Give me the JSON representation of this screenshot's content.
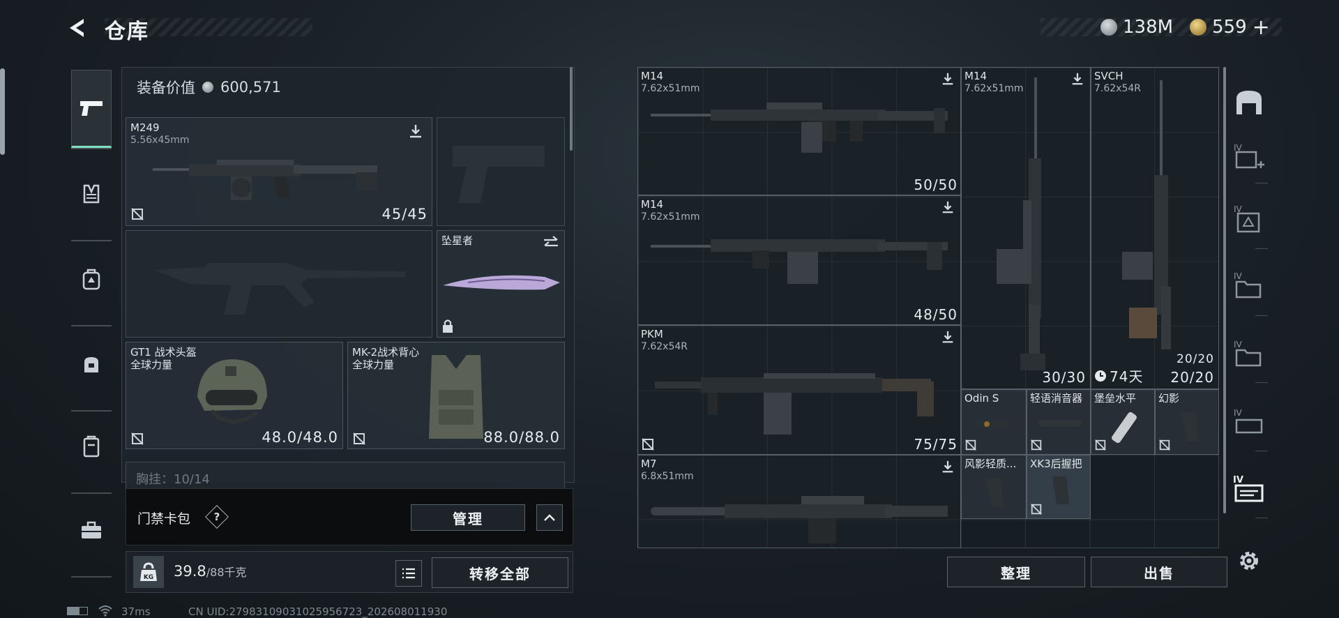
{
  "header": {
    "title": "仓库",
    "currency_silver": "138M",
    "currency_gold": "559",
    "add_label": "+"
  },
  "equipment": {
    "value_label": "装备价值",
    "value": "600,571"
  },
  "slots": {
    "primary": {
      "name": "M249",
      "caliber": "5.56x45mm",
      "ammo": "45/45"
    },
    "melee": {
      "name": "坠星者"
    },
    "helmet": {
      "name": "GT1 战术头盔",
      "brand": "全球力量",
      "durability": "48.0/48.0"
    },
    "vest": {
      "name": "MK-2战术背心",
      "brand": "全球力量",
      "durability": "88.0/88.0"
    },
    "chest_rig_partial": "胸挂：10/14"
  },
  "keycard": {
    "label": "门禁卡包",
    "help": "?",
    "manage_label": "管理"
  },
  "weight": {
    "badge": "KG",
    "current": "39.8",
    "max": "/88千克",
    "transfer_all_label": "转移全部"
  },
  "storage": {
    "weapons": [
      {
        "name": "M14",
        "caliber": "7.62x51mm",
        "ammo": "50/50"
      },
      {
        "name": "M14",
        "caliber": "7.62x51mm",
        "ammo": "48/50"
      },
      {
        "name": "PKM",
        "caliber": "7.62x54R",
        "ammo": "75/75"
      },
      {
        "name": "M7",
        "caliber": "6.8x51mm",
        "ammo": ""
      },
      {
        "name": "M14",
        "caliber": "7.62x51mm",
        "ammo": "30/30"
      },
      {
        "name": "SVCH",
        "caliber": "7.62x54R",
        "ammo": "20/20",
        "ammo_top": "20/20",
        "timer": "74天"
      }
    ],
    "accessories": [
      {
        "name": "Odin S"
      },
      {
        "name": "轻语消音器"
      },
      {
        "name": "堡垒水平"
      },
      {
        "name": "幻影"
      },
      {
        "name": "风影轻质..."
      },
      {
        "name": "XK3后握把"
      }
    ],
    "sort_label": "整理",
    "sell_label": "出售"
  },
  "rail": {
    "labels": [
      "IV",
      "IV",
      "IV",
      "IV",
      "IV",
      "IV"
    ]
  },
  "status_bar": {
    "ping": "37ms",
    "uid": "CN UID:27983109031025956723_202608011930"
  },
  "colors": {
    "accent": "#7fe0c4",
    "panel": "#1e252c",
    "border": "#4a555e"
  }
}
